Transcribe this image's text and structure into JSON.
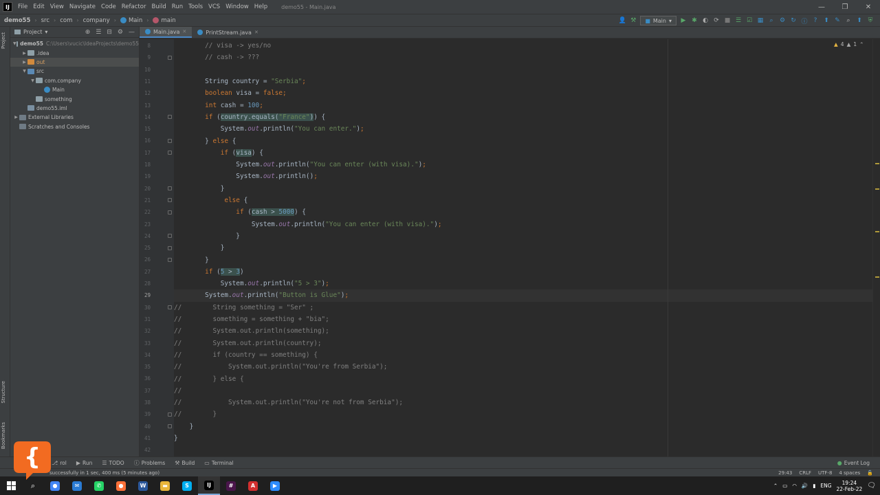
{
  "menubar": {
    "logo": "IJ",
    "items": [
      "File",
      "Edit",
      "View",
      "Navigate",
      "Code",
      "Refactor",
      "Build",
      "Run",
      "Tools",
      "VCS",
      "Window",
      "Help"
    ],
    "window_title": "demo55 - Main.java"
  },
  "navbar": {
    "crumbs": [
      "demo55",
      "src",
      "com",
      "company",
      "Main",
      "main"
    ],
    "run_config": "Main"
  },
  "project_panel": {
    "title": "Project",
    "tree": [
      {
        "label": "demo55",
        "path": "C:\\Users\\vucic\\IdeaProjects\\demo55",
        "depth": 0,
        "expanded": true,
        "icon": "folder-icon"
      },
      {
        "label": ".idea",
        "depth": 1,
        "expanded": false,
        "icon": "folder-icon"
      },
      {
        "label": "out",
        "depth": 1,
        "expanded": false,
        "icon": "folder-orange-icon",
        "selected": true
      },
      {
        "label": "src",
        "depth": 1,
        "expanded": true,
        "icon": "source-folder-icon"
      },
      {
        "label": "com.company",
        "depth": 2,
        "expanded": true,
        "icon": "package-icon"
      },
      {
        "label": "Main",
        "depth": 3,
        "icon": "class-icon"
      },
      {
        "label": "something",
        "depth": 2,
        "icon": "package-icon"
      },
      {
        "label": "demo55.iml",
        "depth": 1,
        "icon": "iml-file-icon"
      },
      {
        "label": "External Libraries",
        "depth": 0,
        "expanded": false,
        "icon": "library-icon"
      },
      {
        "label": "Scratches and Consoles",
        "depth": 0,
        "icon": "scratch-icon"
      }
    ]
  },
  "left_strip": {
    "project": "Project",
    "structure": "Structure",
    "bookmarks": "Bookmarks"
  },
  "tabs": [
    {
      "label": "Main.java",
      "active": true
    },
    {
      "label": "PrintStream.java",
      "active": false
    }
  ],
  "editor": {
    "current_line": 29,
    "inspection": {
      "warnings": "4",
      "weak": "1"
    },
    "lines": [
      {
        "n": 8,
        "tokens": [
          [
            "cm",
            "        // visa -> yes/no"
          ]
        ]
      },
      {
        "n": 9,
        "tokens": [
          [
            "cm",
            "        // cash -> ???"
          ]
        ]
      },
      {
        "n": 10,
        "tokens": []
      },
      {
        "n": 11,
        "tokens": [
          [
            "code-text",
            "        String country = "
          ],
          [
            "str",
            "\"Serbia\""
          ],
          [
            "kw",
            ";"
          ]
        ]
      },
      {
        "n": 12,
        "tokens": [
          [
            "kw",
            "        boolean "
          ],
          [
            "code-text",
            "visa = "
          ],
          [
            "kw",
            "false;"
          ]
        ]
      },
      {
        "n": 13,
        "tokens": [
          [
            "kw",
            "        int "
          ],
          [
            "code-text",
            "cash = "
          ],
          [
            "num",
            "100"
          ],
          [
            "kw",
            ";"
          ]
        ]
      },
      {
        "n": 14,
        "tokens": [
          [
            "kw",
            "        if "
          ],
          [
            "code-text",
            "("
          ],
          [
            "hl",
            "country.equals("
          ],
          [
            "str hl",
            "\"France\""
          ],
          [
            "hl",
            ")"
          ],
          [
            "code-text",
            ") {"
          ]
        ]
      },
      {
        "n": 15,
        "tokens": [
          [
            "code-text",
            "            System."
          ],
          [
            "fld",
            "out"
          ],
          [
            "code-text",
            ".println("
          ],
          [
            "str",
            "\"You can enter.\""
          ],
          [
            "code-text",
            ")"
          ],
          [
            "kw",
            ";"
          ]
        ]
      },
      {
        "n": 16,
        "tokens": [
          [
            "code-text",
            "        } "
          ],
          [
            "kw",
            "else "
          ],
          [
            "code-text",
            "{"
          ]
        ]
      },
      {
        "n": 17,
        "tokens": [
          [
            "kw",
            "            if "
          ],
          [
            "code-text",
            "("
          ],
          [
            "hl",
            "visa"
          ],
          [
            "code-text",
            ") {"
          ]
        ]
      },
      {
        "n": 18,
        "tokens": [
          [
            "code-text",
            "                System."
          ],
          [
            "fld",
            "out"
          ],
          [
            "code-text",
            ".println("
          ],
          [
            "str",
            "\"You can enter (with visa).\""
          ],
          [
            "code-text",
            ")"
          ],
          [
            "kw",
            ";"
          ]
        ]
      },
      {
        "n": 19,
        "tokens": [
          [
            "code-text",
            "                System."
          ],
          [
            "fld",
            "out"
          ],
          [
            "code-text",
            ".println()"
          ],
          [
            "kw",
            ";"
          ]
        ]
      },
      {
        "n": 20,
        "tokens": [
          [
            "code-text",
            "            }"
          ]
        ]
      },
      {
        "n": 21,
        "tokens": [
          [
            "kw",
            "             else "
          ],
          [
            "code-text",
            "{"
          ]
        ]
      },
      {
        "n": 22,
        "tokens": [
          [
            "kw",
            "                if "
          ],
          [
            "code-text",
            "("
          ],
          [
            "hl",
            "cash > "
          ],
          [
            "num hl",
            "5000"
          ],
          [
            "code-text",
            ") {"
          ]
        ]
      },
      {
        "n": 23,
        "tokens": [
          [
            "code-text",
            "                    System."
          ],
          [
            "fld",
            "out"
          ],
          [
            "code-text",
            ".println("
          ],
          [
            "str",
            "\"You can enter (with visa).\""
          ],
          [
            "code-text",
            ")"
          ],
          [
            "kw",
            ";"
          ]
        ]
      },
      {
        "n": 24,
        "tokens": [
          [
            "code-text",
            "                }"
          ]
        ]
      },
      {
        "n": 25,
        "tokens": [
          [
            "code-text",
            "            }"
          ]
        ]
      },
      {
        "n": 26,
        "tokens": [
          [
            "code-text",
            "        }"
          ]
        ]
      },
      {
        "n": 27,
        "tokens": [
          [
            "kw",
            "        if "
          ],
          [
            "code-text",
            "("
          ],
          [
            "num hl",
            "5"
          ],
          [
            "hl",
            " > "
          ],
          [
            "num hl",
            "3"
          ],
          [
            "code-text",
            ")"
          ]
        ]
      },
      {
        "n": 28,
        "tokens": [
          [
            "code-text",
            "            System."
          ],
          [
            "fld",
            "out"
          ],
          [
            "code-text",
            ".println("
          ],
          [
            "str",
            "\"5 > 3\""
          ],
          [
            "code-text",
            ")"
          ],
          [
            "kw",
            ";"
          ]
        ]
      },
      {
        "n": 29,
        "tokens": [
          [
            "code-text",
            "        System."
          ],
          [
            "fld",
            "out"
          ],
          [
            "code-text",
            ".println("
          ],
          [
            "str",
            "\"Button is Glue\""
          ],
          [
            "code-text",
            ")"
          ],
          [
            "kw",
            ";"
          ]
        ]
      },
      {
        "n": 30,
        "tokens": [
          [
            "cm",
            "//        String something = \"Ser\" ;"
          ]
        ]
      },
      {
        "n": 31,
        "tokens": [
          [
            "cm",
            "//        something = something + \"bia\";"
          ]
        ]
      },
      {
        "n": 32,
        "tokens": [
          [
            "cm",
            "//        System.out.println(something);"
          ]
        ]
      },
      {
        "n": 33,
        "tokens": [
          [
            "cm",
            "//        System.out.println(country);"
          ]
        ]
      },
      {
        "n": 34,
        "tokens": [
          [
            "cm",
            "//        if (country == something) {"
          ]
        ]
      },
      {
        "n": 35,
        "tokens": [
          [
            "cm",
            "//            System.out.println(\"You're from Serbia\");"
          ]
        ]
      },
      {
        "n": 36,
        "tokens": [
          [
            "cm",
            "//        } else {"
          ]
        ]
      },
      {
        "n": 37,
        "tokens": [
          [
            "cm",
            "//"
          ]
        ]
      },
      {
        "n": 38,
        "tokens": [
          [
            "cm",
            "//            System.out.println(\"You're not from Serbia\");"
          ]
        ]
      },
      {
        "n": 39,
        "tokens": [
          [
            "cm",
            "//        }"
          ]
        ]
      },
      {
        "n": 40,
        "tokens": [
          [
            "code-text",
            "    }"
          ]
        ]
      },
      {
        "n": 41,
        "tokens": [
          [
            "code-text",
            "}"
          ]
        ]
      },
      {
        "n": 42,
        "tokens": []
      }
    ]
  },
  "bottom_tools": [
    {
      "label": "rol",
      "icon": "version-control-icon"
    },
    {
      "label": "Run",
      "icon": "run-icon"
    },
    {
      "label": "TODO",
      "icon": "todo-icon"
    },
    {
      "label": "Problems",
      "icon": "problems-icon"
    },
    {
      "label": "Build",
      "icon": "build-icon"
    },
    {
      "label": "Terminal",
      "icon": "terminal-icon"
    }
  ],
  "event_log": "Event Log",
  "statusbar": {
    "message": "successfully in 1 sec, 400 ms (5 minutes ago)",
    "position": "29:43",
    "line_sep": "CRLF",
    "encoding": "UTF-8",
    "indent": "4 spaces"
  },
  "taskbar": {
    "apps": [
      {
        "name": "chrome-icon",
        "color": "#4285f4",
        "glyph": "●"
      },
      {
        "name": "mail-icon",
        "color": "#2a7bd4",
        "glyph": "✉"
      },
      {
        "name": "whatsapp-icon",
        "color": "#25d366",
        "glyph": "✆"
      },
      {
        "name": "firefox-icon",
        "color": "#ff7139",
        "glyph": "●"
      },
      {
        "name": "word-icon",
        "color": "#2b579a",
        "glyph": "W"
      },
      {
        "name": "explorer-icon",
        "color": "#e8b53a",
        "glyph": "▬"
      },
      {
        "name": "skype-icon",
        "color": "#00aff0",
        "glyph": "S"
      },
      {
        "name": "intellij-icon",
        "color": "#000000",
        "glyph": "IJ",
        "active": true
      },
      {
        "name": "slack-icon",
        "color": "#4a154b",
        "glyph": "#"
      },
      {
        "name": "acrobat-icon",
        "color": "#d32f2f",
        "glyph": "A"
      },
      {
        "name": "zoom-icon",
        "color": "#2d8cff",
        "glyph": "▶"
      }
    ],
    "lang": "ENG",
    "time": "19:24",
    "date": "22-Feb-22"
  },
  "colors": {
    "editor_bg": "#2b2b2b",
    "panel_bg": "#3c3f41",
    "keyword": "#cc7832",
    "string": "#6a8759",
    "number": "#6897bb",
    "comment": "#808080",
    "field": "#9876aa",
    "overlay_logo": "#f26b21"
  }
}
